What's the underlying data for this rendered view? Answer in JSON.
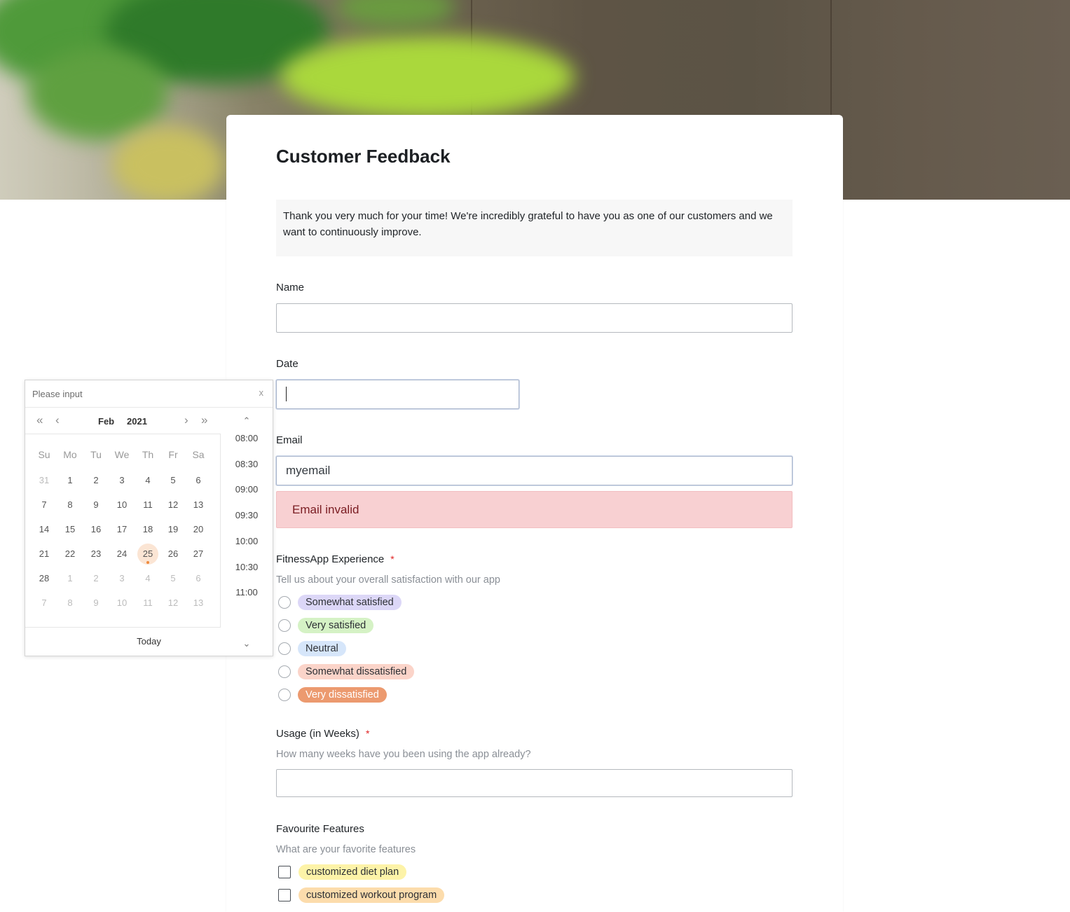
{
  "form": {
    "title": "Customer Feedback",
    "intro": "Thank you very much for your time! We're incredibly grateful to have you as one of our customers and we want to continuously improve."
  },
  "fields": {
    "name": {
      "label": "Name",
      "value": ""
    },
    "date": {
      "label": "Date",
      "value": ""
    },
    "email": {
      "label": "Email",
      "value": "myemail",
      "error": "Email invalid"
    },
    "experience": {
      "label": "FitnessApp Experience",
      "required_mark": "*",
      "description": "Tell us about your overall satisfaction with our app",
      "options": [
        {
          "label": "Somewhat satisfied",
          "color": "#dcd7f7"
        },
        {
          "label": "Very satisfied",
          "color": "#d5f2c5"
        },
        {
          "label": "Neutral",
          "color": "#d6e6fa"
        },
        {
          "label": "Somewhat dissatisfied",
          "color": "#fbd4c9"
        },
        {
          "label": "Very dissatisfied",
          "color": "#ec9a6f"
        }
      ]
    },
    "usage": {
      "label": "Usage (in Weeks)",
      "required_mark": "*",
      "description": "How many weeks have you been using the app already?",
      "value": ""
    },
    "features": {
      "label": "Favourite Features",
      "description": "What are your favorite features",
      "options": [
        {
          "label": "customized diet plan",
          "color": "#fdf3a8"
        },
        {
          "label": "customized workout program",
          "color": "#fcdcac"
        }
      ]
    }
  },
  "datepicker": {
    "placeholder": "Please input",
    "clear": "x",
    "month": "Feb",
    "year": "2021",
    "nav": {
      "prev_year": "«",
      "prev_month": "‹",
      "next_month": "›",
      "next_year": "»"
    },
    "weekdays": [
      "Su",
      "Mo",
      "Tu",
      "We",
      "Th",
      "Fr",
      "Sa"
    ],
    "weeks": [
      [
        "31",
        "1",
        "2",
        "3",
        "4",
        "5",
        "6"
      ],
      [
        "7",
        "8",
        "9",
        "10",
        "11",
        "12",
        "13"
      ],
      [
        "14",
        "15",
        "16",
        "17",
        "18",
        "19",
        "20"
      ],
      [
        "21",
        "22",
        "23",
        "24",
        "25",
        "26",
        "27"
      ],
      [
        "28",
        "1",
        "2",
        "3",
        "4",
        "5",
        "6"
      ],
      [
        "7",
        "8",
        "9",
        "10",
        "11",
        "12",
        "13"
      ]
    ],
    "highlighted_day": "25",
    "times": [
      "08:00",
      "08:30",
      "09:00",
      "09:30",
      "10:00",
      "10:30",
      "11:00"
    ],
    "today_label": "Today",
    "accent_color": "#f08a3c"
  }
}
